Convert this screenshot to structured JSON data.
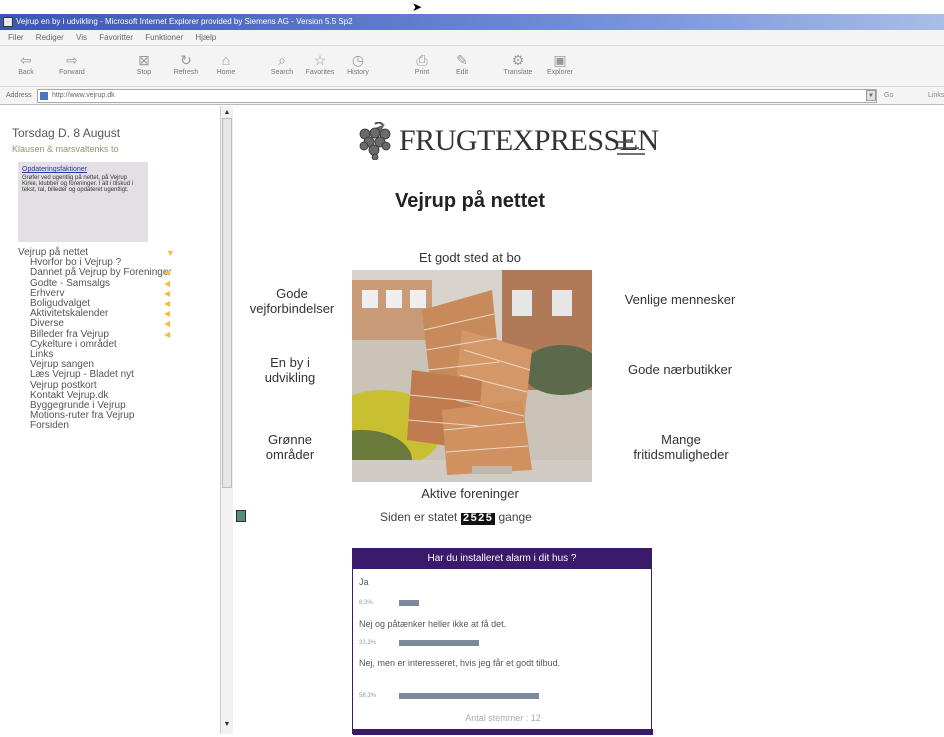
{
  "window": {
    "title": "Vejrup en by i udvikling - Microsoft Internet Explorer provided by Siemens AG - Version 5.5 Sp2"
  },
  "menubar": [
    "Filer",
    "Rediger",
    "Vis",
    "Favoritter",
    "Funktioner",
    "Hjælp"
  ],
  "toolbar": {
    "back": "Back",
    "forward": "Forward",
    "stop": "Stop",
    "refresh": "Refresh",
    "home": "Home",
    "search": "Search",
    "favorites": "Favorites",
    "history": "History",
    "print": "Print",
    "edit": "Edit",
    "translate": "Translate",
    "explorer": "Explorer"
  },
  "addressbar": {
    "label": "Address",
    "url": "http://www.vejrup.dk",
    "go": "Go",
    "links": "Links"
  },
  "sidebar": {
    "date": "Torsdag D. 8 August",
    "welcome": "Klausen & marsvaltenks to",
    "infobox_title": "Opdateringsfaktioner",
    "infobox_text": "Grøfer ved ugentlig på nettet, på Vejrup Kirke, klubber og foreninger. I alt i tilskud i tekst, tal, billeder og opdateret ugentligt.",
    "menu_items": [
      {
        "label": "Vejrup på nettet",
        "arrow": "down",
        "sub": false
      },
      {
        "label": "Hvorfor bo i Vejrup ?",
        "arrow": "",
        "sub": true
      },
      {
        "label": "Dannet på Vejrup by Foreninger",
        "arrow": "left",
        "sub": true
      },
      {
        "label": "Godte - Samsalgs",
        "arrow": "left",
        "sub": true
      },
      {
        "label": "Erhverv",
        "arrow": "left",
        "sub": true
      },
      {
        "label": "Boligudvalget",
        "arrow": "left",
        "sub": true
      },
      {
        "label": "Aktivitetskalender",
        "arrow": "left",
        "sub": true
      },
      {
        "label": "Diverse",
        "arrow": "left",
        "sub": true
      },
      {
        "label": "Billeder fra Vejrup",
        "arrow": "left",
        "sub": true
      },
      {
        "label": "Cykelture i området",
        "arrow": "",
        "sub": true
      },
      {
        "label": "Links",
        "arrow": "",
        "sub": true
      },
      {
        "label": "Vejrup sangen",
        "arrow": "",
        "sub": true
      },
      {
        "label": "Læs Vejrup - Bladet nyt",
        "arrow": "",
        "sub": true
      },
      {
        "label": "Vejrup postkort",
        "arrow": "",
        "sub": true
      },
      {
        "label": "Kontakt Vejrup.dk",
        "arrow": "",
        "sub": true
      },
      {
        "label": "Byggegrunde i Vejrup",
        "arrow": "",
        "sub": true
      },
      {
        "label": "Motions-ruter fra Vejrup",
        "arrow": "",
        "sub": true
      },
      {
        "label": "Forsiden",
        "arrow": "",
        "sub": true
      }
    ]
  },
  "main": {
    "logo_text": "FRUGTEXPRESSEN",
    "heading": "Vejrup på nettet",
    "labels": {
      "top": "Et godt sted at bo",
      "left1": "Gode\nvejforbindelser",
      "left2": "En by i\nudvikling",
      "left3": "Grønne\nområder",
      "right1": "Venlige mennesker",
      "right2": "Gode nærbutikker",
      "right3": "Mange\nfritidsmuligheder",
      "bottom": "Aktive foreninger"
    },
    "counter_prefix": "Siden er statet",
    "counter_value": "2525",
    "counter_suffix": "gange"
  },
  "poll": {
    "title": "Har du installeret alarm i dit hus ?",
    "options": [
      {
        "label": "Ja",
        "pct_label": "8,3%",
        "percent": 8.3
      },
      {
        "label": "Nej og påtænker heller ikke at få det.",
        "pct_label": "33,3%",
        "percent": 33.3
      },
      {
        "label": "Nej, men er interesseret, hvis jeg får et godt tilbud.",
        "pct_label": "58,3%",
        "percent": 58.3
      }
    ],
    "votes": "Antal stemmer : 12"
  },
  "colors": {
    "poll_header": "#3a1a6a",
    "menu_arrow": "#f0c040",
    "titlebar": "#3a56b0"
  }
}
